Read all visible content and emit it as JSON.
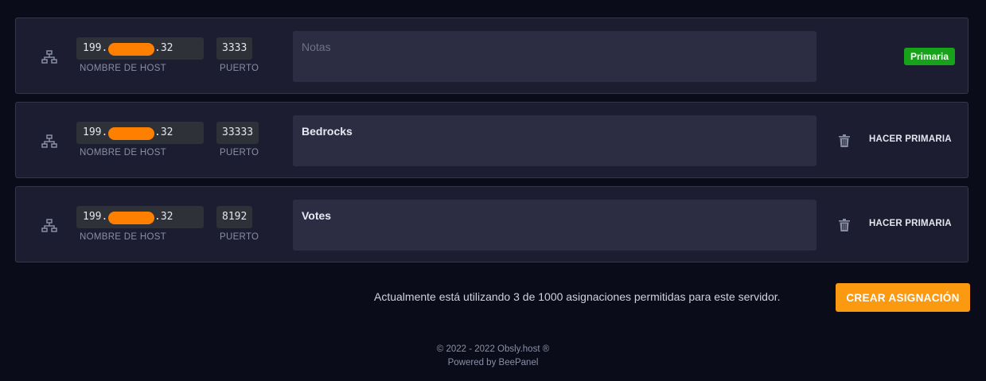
{
  "allocations": [
    {
      "host_prefix": "199.",
      "host_suffix": ".32",
      "host_label": "NOMBRE DE HOST",
      "port": "3333",
      "port_label": "PUERTO",
      "notes_value": "",
      "notes_placeholder": "Notas",
      "badge": "Primaria"
    },
    {
      "host_prefix": "199.",
      "host_suffix": ".32",
      "host_label": "NOMBRE DE HOST",
      "port": "33333",
      "port_label": "PUERTO",
      "notes_value": "Bedrocks",
      "action_label": "HACER PRIMARIA"
    },
    {
      "host_prefix": "199.",
      "host_suffix": ".32",
      "host_label": "NOMBRE DE HOST",
      "port": "8192",
      "port_label": "PUERTO",
      "notes_value": "Votes",
      "action_label": "HACER PRIMARIA"
    }
  ],
  "summary": {
    "text": "Actualmente está utilizando 3 de 1000 asignaciones permitidas para este servidor.",
    "create_button": "CREAR ASIGNACIÓN"
  },
  "footer": {
    "copyright": "© 2022 - 2022 Obsly.host ®",
    "powered_by": "Powered by BeePanel"
  },
  "colors": {
    "background": "#0b0c1a",
    "row_background": "#1c1d30",
    "primary_badge": "#16a31a",
    "create_button": "#fb9a10",
    "redaction": "#ff7f00"
  },
  "icons": {
    "row_icon": "network-icon",
    "delete_icon": "trash-icon"
  }
}
